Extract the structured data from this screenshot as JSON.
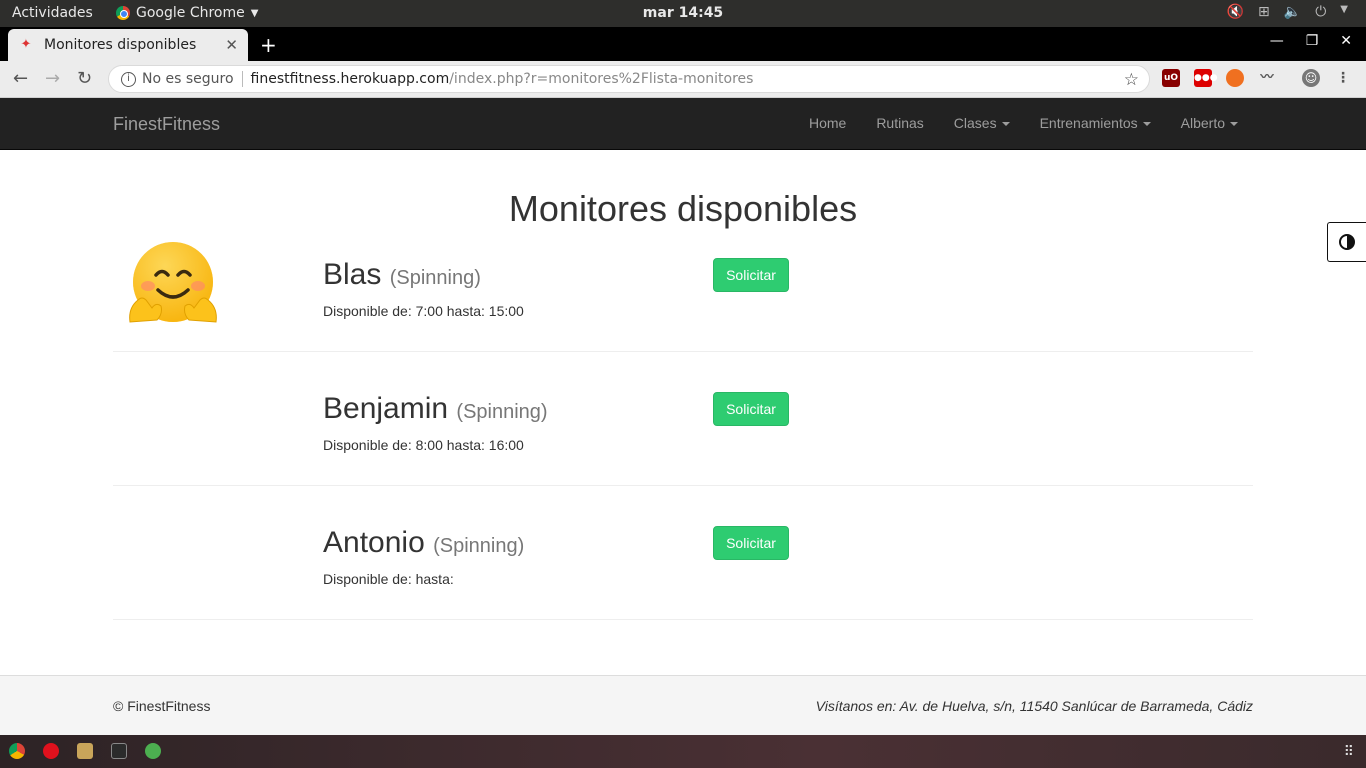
{
  "system_bar": {
    "activities": "Actividades",
    "app_name": "Google Chrome",
    "clock": "mar 14:45"
  },
  "browser": {
    "tab_title": "Monitores disponibles",
    "security_label": "No es seguro",
    "url_host": "finestfitness.herokuapp.com",
    "url_path": "/index.php?r=monitores%2Flista-monitores"
  },
  "navbar": {
    "brand": "FinestFitness",
    "items": [
      {
        "label": "Home",
        "dropdown": false
      },
      {
        "label": "Rutinas",
        "dropdown": false
      },
      {
        "label": "Clases",
        "dropdown": true
      },
      {
        "label": "Entrenamientos",
        "dropdown": true
      },
      {
        "label": "Alberto",
        "dropdown": true
      }
    ]
  },
  "page": {
    "title": "Monitores disponibles",
    "monitors": [
      {
        "name": "Blas",
        "specialty": "(Spinning)",
        "availability": "Disponible de: 7:00 hasta: 15:00",
        "action": "Solicitar",
        "has_avatar": true
      },
      {
        "name": "Benjamin",
        "specialty": "(Spinning)",
        "availability": "Disponible de: 8:00 hasta: 16:00",
        "action": "Solicitar",
        "has_avatar": false
      },
      {
        "name": "Antonio",
        "specialty": "(Spinning)",
        "availability": "Disponible de: hasta:",
        "action": "Solicitar",
        "has_avatar": false
      }
    ]
  },
  "footer": {
    "copyright": "© FinestFitness",
    "address": "Visítanos en: Av. de Huelva, s/n, 11540 Sanlúcar de Barrameda, Cádiz"
  },
  "colors": {
    "navbar_bg": "#222222",
    "button_green": "#2ecc71"
  }
}
